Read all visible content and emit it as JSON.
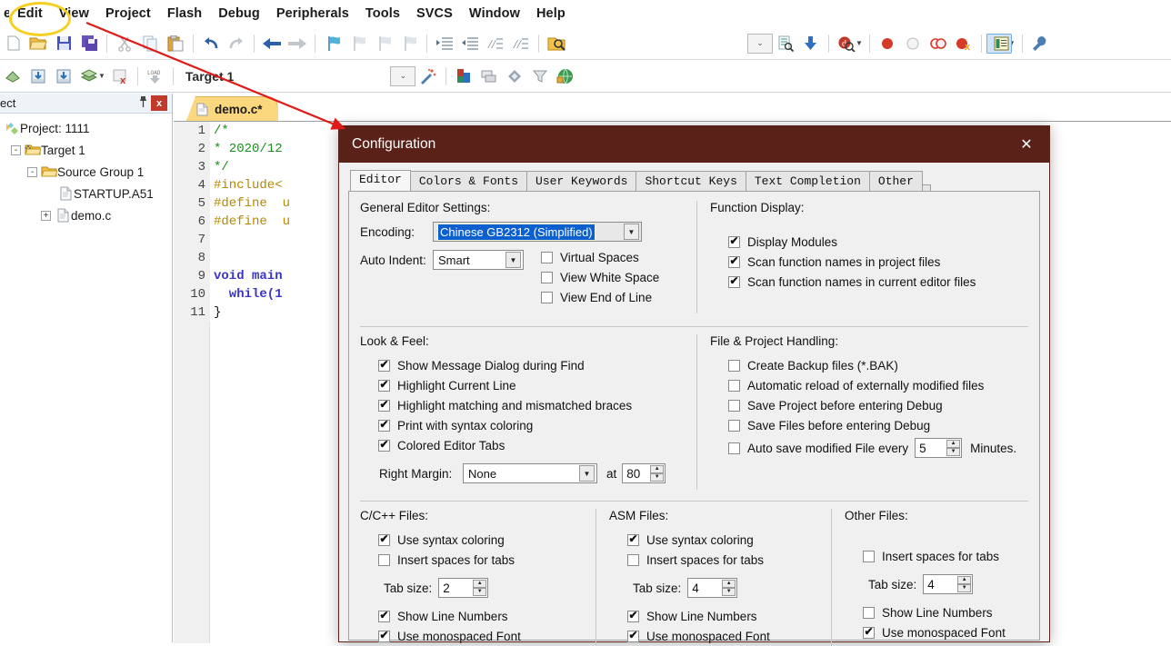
{
  "app": {
    "menu": [
      "e",
      "Edit",
      "View",
      "Project",
      "Flash",
      "Debug",
      "Peripherals",
      "Tools",
      "SVCS",
      "Window",
      "Help"
    ],
    "toolbar1": [
      {
        "name": "new-file-icon",
        "glyph": "□"
      },
      {
        "name": "open-file-icon",
        "glyph": "📂"
      },
      {
        "name": "save-icon",
        "glyph": "💾"
      },
      {
        "name": "save-all-icon",
        "glyph": "🖫"
      },
      {
        "name": "cut-icon",
        "glyph": "✂"
      },
      {
        "name": "copy-icon",
        "glyph": "❐"
      },
      {
        "name": "paste-icon",
        "glyph": "📋"
      },
      {
        "name": "undo-icon",
        "glyph": "↶"
      },
      {
        "name": "redo-icon",
        "glyph": "↷"
      },
      {
        "name": "navigate-back-icon",
        "glyph": "←"
      },
      {
        "name": "navigate-forward-icon",
        "glyph": "→"
      },
      {
        "name": "bookmark-toggle-icon",
        "glyph": "⚑"
      },
      {
        "name": "bookmark-prev-icon",
        "glyph": "⚑"
      },
      {
        "name": "bookmark-next-icon",
        "glyph": "⚑"
      },
      {
        "name": "bookmark-clear-icon",
        "glyph": "⚑"
      },
      {
        "name": "indent-icon",
        "glyph": "⇥"
      },
      {
        "name": "outdent-icon",
        "glyph": "⇤"
      },
      {
        "name": "comment-icon",
        "glyph": "//"
      },
      {
        "name": "uncomment-icon",
        "glyph": "//"
      },
      {
        "name": "find-in-files-icon",
        "glyph": "🔍"
      }
    ],
    "toolbar1_right": [
      {
        "name": "view-dropdown-combo",
        "glyph": "⌄"
      },
      {
        "name": "target-options-icon",
        "glyph": "📄"
      },
      {
        "name": "download-icon",
        "glyph": "⬇"
      },
      {
        "name": "debug-session-icon",
        "glyph": "d"
      },
      {
        "name": "breakpoint-insert-icon",
        "glyph": "●"
      },
      {
        "name": "breakpoint-disable-icon",
        "glyph": "○"
      },
      {
        "name": "breakpoint-disable-all-icon",
        "glyph": "◎"
      },
      {
        "name": "breakpoint-kill-all-icon",
        "glyph": "●"
      },
      {
        "name": "project-window-icon",
        "glyph": "☰"
      },
      {
        "name": "configuration-wrench-icon",
        "glyph": "🔧"
      }
    ],
    "toolbar2_left": [
      {
        "name": "translate-icon",
        "glyph": "◈"
      },
      {
        "name": "build-icon",
        "glyph": "▦"
      },
      {
        "name": "rebuild-icon",
        "glyph": "▦"
      },
      {
        "name": "batch-build-icon",
        "glyph": "≣"
      },
      {
        "name": "stop-build-icon",
        "glyph": "▦"
      },
      {
        "name": "download-load-icon",
        "glyph": "LOAD"
      }
    ],
    "toolbar2_target": "Target 1",
    "toolbar2_right": [
      {
        "name": "target-select-combo",
        "glyph": "⌄"
      },
      {
        "name": "target-options-magic-icon",
        "glyph": "✨"
      },
      {
        "name": "manage-project-items-icon",
        "glyph": "■"
      },
      {
        "name": "manage-multi-project-icon",
        "glyph": "❐"
      },
      {
        "name": "components-icon",
        "glyph": "❖"
      },
      {
        "name": "filter-icon",
        "glyph": "▽"
      },
      {
        "name": "pack-installer-icon",
        "glyph": "🌐"
      }
    ]
  },
  "project_panel": {
    "title": "ect",
    "pin_glyph": "⚓",
    "close_label": "x",
    "tree": [
      {
        "label": "Project: 1111",
        "depth": 0,
        "expander": "",
        "icon": "project-icon"
      },
      {
        "label": "Target 1",
        "depth": 1,
        "expander": "-",
        "icon": "target-folder-icon"
      },
      {
        "label": "Source Group 1",
        "depth": 2,
        "expander": "-",
        "icon": "folder-icon"
      },
      {
        "label": "STARTUP.A51",
        "depth": 3,
        "expander": "",
        "icon": "file-icon"
      },
      {
        "label": "demo.c",
        "depth": 3,
        "expander": "+",
        "icon": "file-icon"
      }
    ]
  },
  "editor": {
    "tab_label": "demo.c*",
    "lines": [
      {
        "no": "1",
        "text": "/*",
        "cls": "c-cmt"
      },
      {
        "no": "2",
        "text": "* 2020/12",
        "cls": "c-cmt"
      },
      {
        "no": "3",
        "text": "*/",
        "cls": "c-cmt"
      },
      {
        "no": "4",
        "text": "#include<",
        "cls": "c-pre"
      },
      {
        "no": "5",
        "text": "#define  u",
        "cls": "c-pre"
      },
      {
        "no": "6",
        "text": "#define  u",
        "cls": "c-pre"
      },
      {
        "no": "7",
        "text": "",
        "cls": "c-pl"
      },
      {
        "no": "8",
        "text": "",
        "cls": "c-pl"
      },
      {
        "no": "9",
        "text": "void main",
        "cls": "c-kw"
      },
      {
        "no": "10",
        "text": "  while(1",
        "cls": "c-kw"
      },
      {
        "no": "11",
        "text": "}",
        "cls": "c-pl"
      }
    ]
  },
  "dialog": {
    "title": "Configuration",
    "close_label": "✕",
    "titlebar_color": "#5a2118",
    "tabs": [
      {
        "label": "Editor",
        "active": true
      },
      {
        "label": "Colors & Fonts",
        "active": false
      },
      {
        "label": "User Keywords",
        "active": false
      },
      {
        "label": "Shortcut Keys",
        "active": false
      },
      {
        "label": "Text Completion",
        "active": false
      },
      {
        "label": "Other",
        "active": false
      }
    ],
    "general_editor_settings": {
      "title": "General Editor Settings:",
      "encoding_label": "Encoding:",
      "encoding_value": "Chinese GB2312 (Simplified)",
      "auto_indent_label": "Auto Indent:",
      "auto_indent_value": "Smart",
      "checks": [
        {
          "label": "Virtual Spaces",
          "checked": false
        },
        {
          "label": "View White Space",
          "checked": false
        },
        {
          "label": "View End of Line",
          "checked": false
        }
      ]
    },
    "function_display": {
      "title": "Function Display:",
      "checks": [
        {
          "label": "Display Modules",
          "checked": true
        },
        {
          "label": "Scan function names in project files",
          "checked": true
        },
        {
          "label": "Scan function names in current editor files",
          "checked": true
        }
      ]
    },
    "look_and_feel": {
      "title": "Look & Feel:",
      "checks": [
        {
          "label": "Show Message Dialog during Find",
          "checked": true
        },
        {
          "label": "Highlight Current Line",
          "checked": true
        },
        {
          "label": "Highlight matching and mismatched braces",
          "checked": true
        },
        {
          "label": "Print with syntax coloring",
          "checked": true
        },
        {
          "label": "Colored Editor Tabs",
          "checked": true
        }
      ],
      "right_margin_label": "Right Margin:",
      "right_margin_value": "None",
      "at_label": "at",
      "at_value": "80"
    },
    "file_project_handling": {
      "title": "File & Project Handling:",
      "checks": [
        {
          "label": "Create Backup files (*.BAK)",
          "checked": false
        },
        {
          "label": "Automatic reload of externally modified files",
          "checked": false
        },
        {
          "label": "Save Project before entering Debug",
          "checked": false
        },
        {
          "label": "Save Files before entering Debug",
          "checked": false
        }
      ],
      "autosave_label": "Auto save modified File every",
      "autosave_checked": false,
      "autosave_value": "5",
      "autosave_suffix": "Minutes."
    },
    "c_files": {
      "title": "C/C++ Files:",
      "syntax_label": "Use syntax coloring",
      "syntax_checked": true,
      "spaces_label": "Insert spaces for tabs",
      "spaces_checked": false,
      "tabsize_label": "Tab size:",
      "tabsize_value": "2",
      "linenum_label": "Show Line Numbers",
      "linenum_checked": true,
      "mono_label": "Use monospaced Font",
      "mono_checked": true
    },
    "asm_files": {
      "title": "ASM Files:",
      "syntax_label": "Use syntax coloring",
      "syntax_checked": true,
      "spaces_label": "Insert spaces for tabs",
      "spaces_checked": false,
      "tabsize_label": "Tab size:",
      "tabsize_value": "4",
      "linenum_label": "Show Line Numbers",
      "linenum_checked": true,
      "mono_label": "Use monospaced Font",
      "mono_checked": true
    },
    "other_files": {
      "title": "Other Files:",
      "spaces_label": "Insert spaces for tabs",
      "spaces_checked": false,
      "tabsize_label": "Tab size:",
      "tabsize_value": "4",
      "linenum_label": "Show Line Numbers",
      "linenum_checked": false,
      "mono_label": "Use monospaced Font",
      "mono_checked": true
    }
  },
  "annotations": {
    "ellipse_color": "#f5d020",
    "arrow_color": "#e01b17"
  }
}
